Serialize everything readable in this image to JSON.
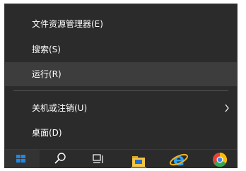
{
  "context_menu": {
    "items": [
      {
        "label": "文件资源管理器(E)"
      },
      {
        "label": "搜索(S)"
      },
      {
        "label": "运行(R)"
      },
      {
        "label": "关机或注销(U)",
        "has_submenu": true
      },
      {
        "label": "桌面(D)"
      }
    ]
  },
  "taskbar": {
    "buttons": [
      {
        "icon": "windows-start-icon"
      },
      {
        "icon": "search-icon"
      },
      {
        "icon": "task-view-icon"
      },
      {
        "icon": "file-explorer-icon"
      },
      {
        "icon": "internet-explorer-icon"
      },
      {
        "icon": "chrome-icon"
      }
    ]
  },
  "colors": {
    "menu_bg": "#2b2b2b",
    "hover_bg": "#3d3d3d",
    "separator": "#555555",
    "start_blue": "#1e88e5"
  }
}
